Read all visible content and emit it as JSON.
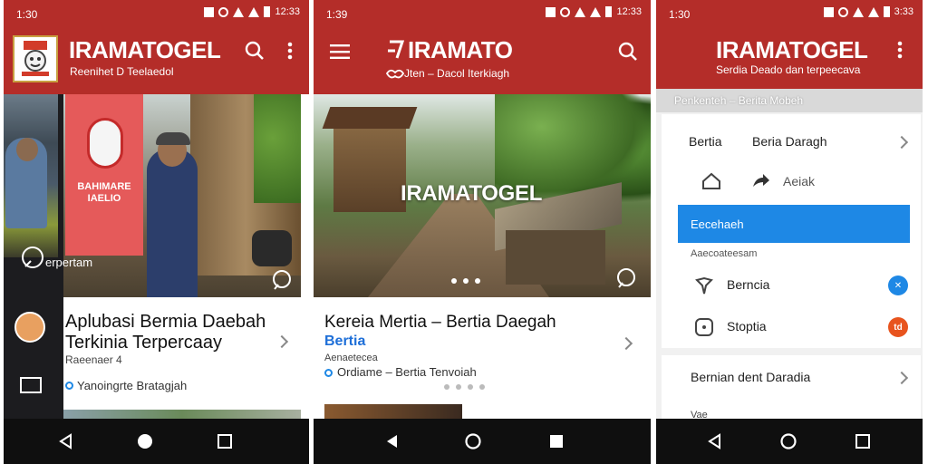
{
  "colors": {
    "primary": "#b42d29",
    "accent_blue": "#1e88e5",
    "badge_orange": "#e8541e",
    "nav_bar": "#0f0f0f"
  },
  "screen1": {
    "status_time": "1:30",
    "status_right": "12:33",
    "title": "IRAMATOGEL",
    "subtitle": "Reenihet D Teelaedol",
    "side_label": "erpertam",
    "card_title": "Aplubasi Bermia Daebah Terkinia Terpercaay",
    "card_meta": "Raeenaer 4",
    "card_source": "Yanoingrte Bratagjah",
    "flag_text": "BAHIMARE IAELIO"
  },
  "screen2": {
    "status_time": "1:39",
    "status_right": "12:33",
    "title": "IRAMATO",
    "subtitle": "Jten – Dacol Iterkiagh",
    "hero_text": "IRAMATOGEL",
    "card_title": "Kereia Mertia – Bertia Daegah",
    "card_tag": "Bertia",
    "card_meta": "Aenaetecea",
    "card_source": "Ordiame – Bertia Tenvoiah"
  },
  "screen3": {
    "status_time": "1:30",
    "status_right": "3:33",
    "title": "IRAMATOGEL",
    "subtitle": "Serdia Deado dan terpeecava",
    "breadcrumb": "Penkenteh – Berita Mobeh",
    "menu": {
      "bertia_label": "Bertia",
      "bertia_value": "Beria Daragh",
      "home_label": "Aeiak",
      "selected_label": "Eecehaeh",
      "section_label": "Aaecoateesam",
      "item1_label": "Berncia",
      "item1_badge": "✕",
      "item2_label": "Stoptia",
      "item2_badge": "td",
      "footer_label": "Bernian dent Daradia",
      "partial_label": "Vae"
    }
  }
}
